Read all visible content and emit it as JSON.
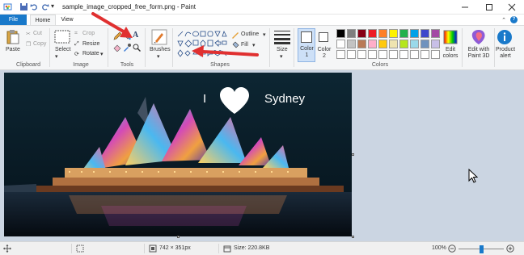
{
  "window": {
    "title": "sample_image_cropped_free_form.png - Paint"
  },
  "tabs": [
    {
      "label": "File"
    },
    {
      "label": "Home"
    },
    {
      "label": "View"
    }
  ],
  "ribbon": {
    "clipboard": {
      "paste": "Paste",
      "cut": "Cut",
      "copy": "Copy",
      "group": "Clipboard"
    },
    "image": {
      "select": "Select",
      "crop": "Crop",
      "resize": "Resize",
      "rotate": "Rotate",
      "group": "Image"
    },
    "tools": {
      "group": "Tools"
    },
    "brushes": {
      "label": "Brushes"
    },
    "shapes": {
      "outline": "Outline",
      "fill": "Fill",
      "group": "Shapes"
    },
    "size": {
      "label": "Size"
    },
    "colors": {
      "color1": "Color 1",
      "color2": "Color 2",
      "edit": "Edit colors",
      "group": "Colors",
      "palette_row1": [
        "#000000",
        "#7f7f7f",
        "#880015",
        "#ed1c24",
        "#ff7f27",
        "#fff200",
        "#22b14c",
        "#00a2e8",
        "#3f48cc",
        "#a349a4"
      ],
      "palette_row2": [
        "#ffffff",
        "#c3c3c3",
        "#b97a57",
        "#ffaec9",
        "#ffc90e",
        "#efe4b0",
        "#b5e61d",
        "#99d9ea",
        "#7092be",
        "#c8bfe7"
      ]
    },
    "paint3d": {
      "label": "Edit with Paint 3D"
    },
    "alert": {
      "label": "Product alert"
    }
  },
  "canvas": {
    "caption_left": "I",
    "caption_right": "Sydney"
  },
  "status": {
    "dimensions": "742 × 351px",
    "size": "Size: 220.8KB",
    "zoom": "100%",
    "zoom_level": 0.5
  },
  "colors": {
    "accent": "#1979ca",
    "arrow": "#e03030"
  }
}
